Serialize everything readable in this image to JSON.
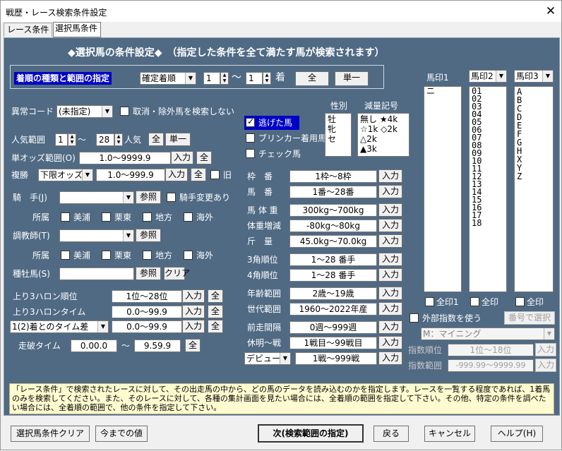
{
  "window": {
    "title": "戦歴・レース検索条件設定",
    "close": "✕"
  },
  "tabs": [
    "レース条件",
    "選択馬条件"
  ],
  "header": "◆選択馬の条件設定◆　（指定した条件を全て満たす馬が検索されます）",
  "order": {
    "label": "着順の種類と範囲の指定",
    "type": "確定着順",
    "from": "1",
    "tilde": "～",
    "to": "1",
    "unit": "着",
    "all_btn": "全",
    "single_btn": "単一"
  },
  "abnormal": {
    "label": "異常コード",
    "value": "(未指定)",
    "cancel_label": "取消・除外馬を検索しない"
  },
  "popularity": {
    "label": "人気範囲",
    "from": "1",
    "tilde": "～",
    "to": "28",
    "unit": "人気",
    "all_btn": "全",
    "single_btn": "単一"
  },
  "odds": {
    "label": "単オッズ範囲(O)",
    "value": "1.0～9999.9",
    "input_btn": "入力",
    "all_btn": "全"
  },
  "place": {
    "label": "複勝",
    "type": "下限オッズ",
    "value": "1.0～999.9",
    "input_btn": "入力",
    "all_btn": "全",
    "old_label": "旧"
  },
  "jockey": {
    "label": "騎　手(J)",
    "ref_btn": "参照",
    "change_label": "騎手変更あり"
  },
  "affil": {
    "label": "所属",
    "opts": [
      "美浦",
      "栗東",
      "地方",
      "海外"
    ]
  },
  "trainer": {
    "label": "調教師(T)",
    "ref_btn": "参照"
  },
  "sire": {
    "label": "種牡馬(S)",
    "ref_btn": "参照",
    "clear_btn": "クリア"
  },
  "agari_rank": {
    "label": "上り3ハロン順位",
    "value": "1位～28位",
    "input_btn": "入力",
    "all_btn": "全"
  },
  "agari_time": {
    "label": "上り3ハロンタイム",
    "value": "0.0～99.9",
    "input_btn": "入力",
    "all_btn": "全"
  },
  "diff": {
    "type": "1(2)着とのタイム差",
    "value": "0.0～99.9",
    "input_btn": "入力",
    "all_btn": "全"
  },
  "run_time": {
    "label": "走破タイム",
    "from": "0.00.0",
    "tilde": "～",
    "to": "9.59.9",
    "all_btn": "全"
  },
  "flags": {
    "nige": "逃げた馬",
    "blinker": "ブリンカー着用馬",
    "check": "チェック馬"
  },
  "sex": {
    "label": "性別",
    "items": "牡\n牝\nセ"
  },
  "weight_mark": {
    "label": "減量記号",
    "items": "無し ★4k\n☆1k ◇2k\n△2k\n▲3k"
  },
  "ranges": [
    {
      "label": "枠　番",
      "value": "1枠～8枠"
    },
    {
      "label": "馬　番",
      "value": "1番～28番"
    },
    {
      "label": "馬 体 重",
      "value": "300kg～700kg"
    },
    {
      "label": "体重増減",
      "value": "-80kg～80kg"
    },
    {
      "label": "斤　量",
      "value": "45.0kg～70.0kg"
    },
    {
      "label": "3角順位",
      "value": "1～28 番手"
    },
    {
      "label": "4角順位",
      "value": "1～28 番手"
    },
    {
      "label": "年齢範囲",
      "value": "2歳～19歳"
    },
    {
      "label": "世代範囲",
      "value": "1960～2022年産"
    },
    {
      "label": "前走間隔",
      "value": "0週～999週"
    },
    {
      "label": "休明～戦",
      "value": "1戦目～99戦目"
    }
  ],
  "debut": {
    "type": "デビュー",
    "value": "1戦～999戦"
  },
  "input_btn": "入力",
  "mark1": {
    "label": "馬印1",
    "items": "ニ",
    "all_label": "全印1"
  },
  "mark2": {
    "label": "馬印2",
    "items": "01\n02\n03\n04\n05\n06\n07\n08\n09\n10\n11\n12\n13\n14\n15\n16\n17\n18",
    "all_label": "全印"
  },
  "mark3": {
    "label": "馬印3",
    "items": "A\nB\nC\nD\nE\nF\nG\nH\nX\nY\nZ",
    "all_label": "全印"
  },
  "ext": {
    "label": "外部指数を使う",
    "select_btn": "番号で選択",
    "index_type": "M：マイニング",
    "rank_label": "指数順位",
    "rank_value": "1位～18位",
    "val_label": "指数範囲",
    "val_value": "-999.99～9999.99",
    "input_btn": "入力"
  },
  "hint": "「レース条件」で検索されたレースに対して、その出走馬の中から、どの馬のデータを読み込むのかを指定します。レースを一覧する程度であれば、1着馬のみを検索してください。また、そのレースに対して、各種の集計画面を見たい場合には、全着順の範囲を指定して下さい。その他、特定の条件を調べたい場合には、全着順の範囲で、他の条件を指定して下さい。",
  "footer": {
    "clear": "選択馬条件クリア",
    "prev": "今までの値",
    "next": "次(検索範囲の指定)",
    "back": "戻る",
    "cancel": "キャンセル",
    "help": "ヘルプ(H)"
  }
}
